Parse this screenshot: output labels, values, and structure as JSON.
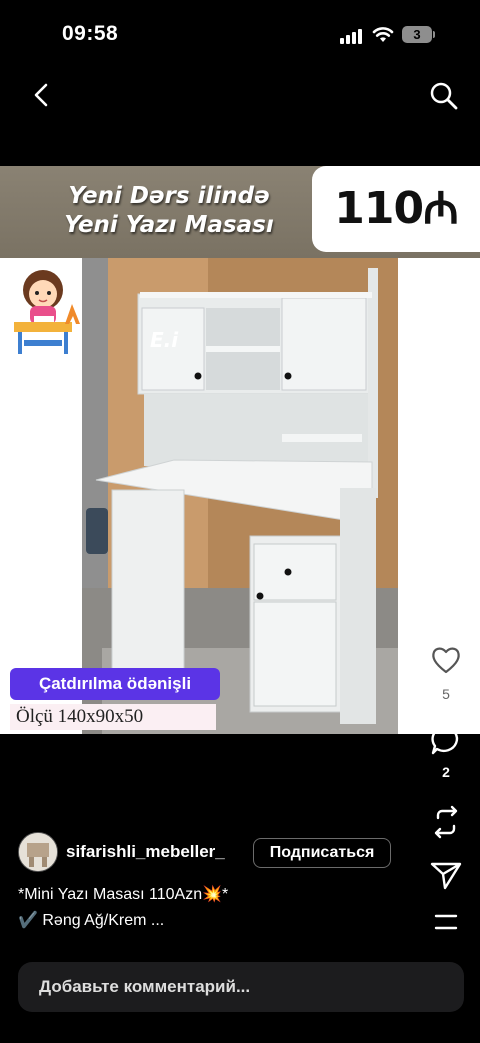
{
  "status_bar": {
    "time": "09:58",
    "battery": "3"
  },
  "post": {
    "banner_line1": "Yeni Dərs ilində",
    "banner_line2": "Yeni Yazı Masası",
    "price": "110₼",
    "logo_text": "E.i",
    "delivery_label": "Çatdırılma ödənişli",
    "size_label": "Ölçü 140x90x50"
  },
  "actions": {
    "likes": "5",
    "comments": "2"
  },
  "account": {
    "username": "sifarishli_mebeller_",
    "subscribe_label": "Подписаться"
  },
  "caption": {
    "line1": "*Mini Yazı Masası 110Azn💥*",
    "line2": "✔️ Rəng Ağ/Krem ..."
  },
  "comment_box": {
    "placeholder": "Добавьте комментарий..."
  },
  "colors": {
    "accent_badge": "#5b34e6",
    "background": "#000000",
    "banner": "#7f7767"
  }
}
